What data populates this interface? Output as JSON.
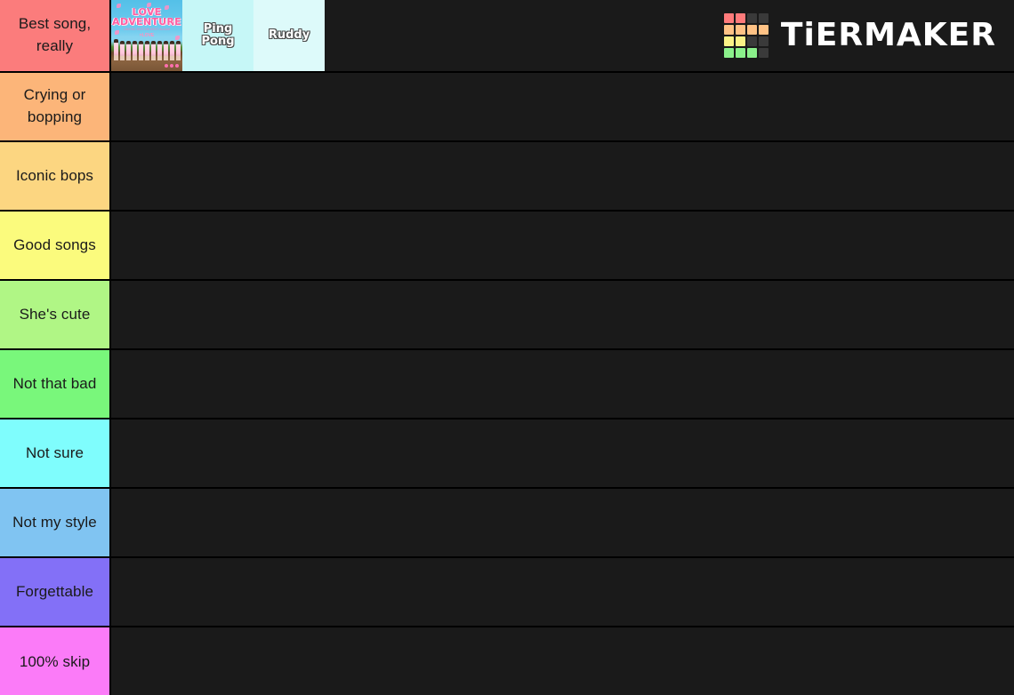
{
  "app": {
    "name": "TierMaker",
    "brand_text": "TiERMAKER",
    "background_color": "#000000",
    "row_background_color": "#1a1a1a"
  },
  "logo": {
    "cell_colors": [
      "#ff7b7b",
      "#ff7b7b",
      "#3a3a3a",
      "#3a3a3a",
      "#ffc285",
      "#ffc285",
      "#ffc285",
      "#ffc285",
      "#fbf286",
      "#fbf286",
      "#3a3a3a",
      "#3a3a3a",
      "#8bf08b",
      "#8bf08b",
      "#8bf08b",
      "#3a3a3a"
    ]
  },
  "tiers": [
    {
      "label": "Best song, really",
      "color": "#fb7c7c",
      "items": [
        {
          "type": "image",
          "name": "Love Adventure album cover",
          "title": "LOVE ADVENTURE",
          "subtitle": "LIMITED EDITION BEST ALBUM",
          "artist_logo": "=LOVE",
          "background_color": "#6ecbee"
        },
        {
          "type": "text",
          "name": "Ping Pong",
          "label": "Ping Pong",
          "background_color": "#c6f7f7"
        },
        {
          "type": "text",
          "name": "Ruddy",
          "label": "Ruddy",
          "background_color": "#ddfafa"
        }
      ]
    },
    {
      "label": "Crying or bopping",
      "color": "#fcb579",
      "items": []
    },
    {
      "label": "Iconic bops",
      "color": "#fcd681",
      "items": []
    },
    {
      "label": "Good songs",
      "color": "#fbfb7d",
      "items": []
    },
    {
      "label": "She's cute",
      "color": "#b0f685",
      "items": []
    },
    {
      "label": "Not that bad",
      "color": "#79f77b",
      "items": []
    },
    {
      "label": "Not sure",
      "color": "#7ffdfd",
      "items": []
    },
    {
      "label": "Not my style",
      "color": "#80c4f2",
      "items": []
    },
    {
      "label": "Forgettable",
      "color": "#8370f7",
      "items": []
    },
    {
      "label": "100% skip",
      "color": "#fb7bf8",
      "items": []
    }
  ]
}
